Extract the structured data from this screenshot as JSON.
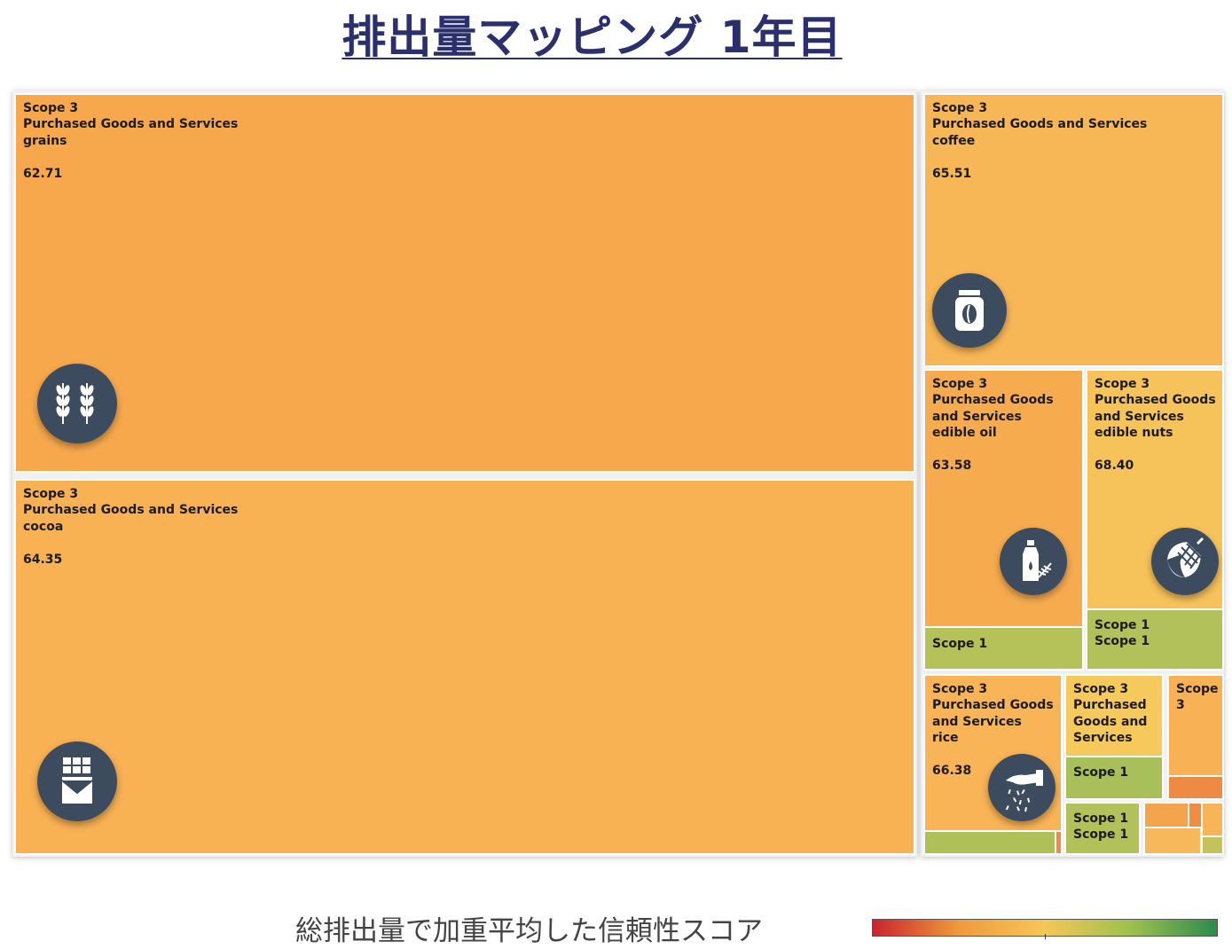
{
  "title": "排出量マッピング 1年目",
  "chart_data": {
    "type": "treemap",
    "title": "排出量マッピング 1年目",
    "color_legend": {
      "label": "総排出量で加重平均した信頼性スコア",
      "colors": [
        "#c9242e",
        "#f09a3e",
        "#f5c658",
        "#9ec050",
        "#2e8a4e"
      ]
    },
    "nodes": [
      {
        "scope": "Scope 3",
        "category": "Purchased Goods and Services",
        "item": "grains",
        "value": "62.71",
        "color": "#f7a84c",
        "icon": "wheat-icon"
      },
      {
        "scope": "Scope 3",
        "category": "Purchased Goods and Services",
        "item": "cocoa",
        "value": "64.35",
        "color": "#f8b153",
        "icon": "chocolate-bar-icon"
      },
      {
        "scope": "Scope 3",
        "category": "Purchased Goods and Services",
        "item": "coffee",
        "value": "65.51",
        "color": "#f8b757",
        "icon": "coffee-jar-icon"
      },
      {
        "scope": "Scope 3",
        "category": "Purchased Goods and Services",
        "item": "edible oil",
        "value": "63.58",
        "color": "#f7ab4f",
        "icon": "oil-bottle-icon"
      },
      {
        "scope": "Scope 3",
        "category": "Purchased Goods and Services",
        "item": "edible nuts",
        "value": "68.40",
        "color": "#f6c25a",
        "icon": "acorn-icon"
      },
      {
        "scope": "Scope 3",
        "category": "Purchased Goods and Services",
        "item": "rice",
        "value": "66.38",
        "color": "#f8b456",
        "icon": "rice-hand-icon"
      },
      {
        "scope": "Scope 1",
        "color": "#b5c159"
      },
      {
        "scope": "Scope 1",
        "subscope": "Scope 1",
        "color": "#b2c15a"
      },
      {
        "scope": "Scope 3",
        "category": "Purchased Goods and Services",
        "color": "#f6c95d"
      },
      {
        "scope": "Scope 1",
        "color": "#a9c05a"
      },
      {
        "scope": "Scope 3",
        "color": "#f8b155"
      },
      {
        "scope": "Scope 1",
        "subscope": "Scope 1",
        "color": "#b3c15b"
      }
    ]
  },
  "cells": {
    "grains": {
      "l1": "Scope 3",
      "l2": "Purchased Goods and Services",
      "l3": "grains",
      "val": "62.71"
    },
    "cocoa": {
      "l1": "Scope 3",
      "l2": "Purchased Goods and Services",
      "l3": "cocoa",
      "val": "64.35"
    },
    "coffee": {
      "l1": "Scope 3",
      "l2": "Purchased Goods and Services",
      "l3": "coffee",
      "val": "65.51"
    },
    "oil": {
      "l1": "Scope 3",
      "l2a": "Purchased Goods",
      "l2b": "and Services",
      "l3": "edible oil",
      "val": "63.58"
    },
    "nuts": {
      "l1": "Scope 3",
      "l2a": "Purchased Goods",
      "l2b": "and Services",
      "l3": "edible nuts",
      "val": "68.40"
    },
    "rice": {
      "l1": "Scope 3",
      "l2a": "Purchased Goods",
      "l2b": "and Services",
      "l3": "rice",
      "val": "66.38"
    },
    "oil_s1": {
      "l1": "Scope 1"
    },
    "nuts_s1": {
      "l1": "Scope 1",
      "l2": "Scope 1"
    },
    "pgs": {
      "l1": "Scope 3",
      "l2": "Purchased",
      "l3": "Goods and",
      "l4": "Services"
    },
    "pgs_s1": {
      "l1": "Scope 1"
    },
    "small": {
      "l1": "Scope",
      "l2": "3"
    },
    "s1s1": {
      "l1": "Scope 1",
      "l2": "Scope 1"
    }
  },
  "legend": {
    "label": "総排出量で加重平均した信頼性スコア"
  }
}
